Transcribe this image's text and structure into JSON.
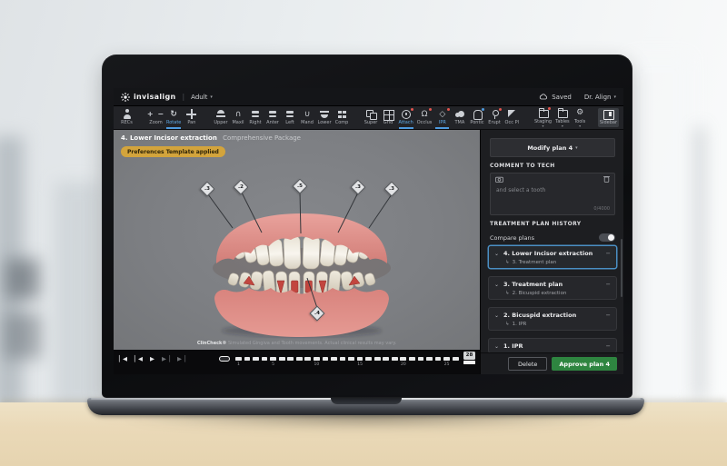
{
  "topbar": {
    "logo": "invisalign",
    "mode": "Adult",
    "saved_label": "Saved",
    "doctor": "Dr. Align"
  },
  "toolbar": {
    "items": [
      {
        "label": "RECs",
        "icon": "person-icon"
      },
      {
        "label": "Zoom",
        "icon": "zoom-icon",
        "gap": true
      },
      {
        "label": "Rotate",
        "icon": "rotate-icon",
        "active": true
      },
      {
        "label": "Pan",
        "icon": "pan-icon"
      },
      {
        "label": "Upper",
        "icon": "upper-view-icon",
        "gap": true
      },
      {
        "label": "Maxil",
        "icon": "maxillary-arch-icon"
      },
      {
        "label": "Right",
        "icon": "right-view-icon"
      },
      {
        "label": "Anter",
        "icon": "anterior-view-icon"
      },
      {
        "label": "Left",
        "icon": "left-view-icon"
      },
      {
        "label": "Mand",
        "icon": "mandibular-arch-icon"
      },
      {
        "label": "Lower",
        "icon": "lower-view-icon"
      },
      {
        "label": "Comp",
        "icon": "composite-view-icon"
      },
      {
        "label": "Super",
        "icon": "superimpose-icon",
        "gap": true
      },
      {
        "label": "Grid",
        "icon": "grid-icon"
      },
      {
        "label": "Attach",
        "icon": "attachments-icon",
        "active": true,
        "dot": "red"
      },
      {
        "label": "Occlus",
        "icon": "occlusion-icon",
        "dot": "red"
      },
      {
        "label": "IPR",
        "icon": "ipr-icon",
        "active": true,
        "dot": "red"
      },
      {
        "label": "TMA",
        "icon": "tma-icon"
      },
      {
        "label": "Pontic",
        "icon": "pontic-icon",
        "dot": "blue"
      },
      {
        "label": "Erupt",
        "icon": "eruption-icon",
        "dot": "red"
      },
      {
        "label": "Occ Pl",
        "icon": "occlusal-plane-icon"
      },
      {
        "label": "Staging",
        "icon": "staging-icon",
        "dot": "red",
        "caret": true,
        "gap": true
      },
      {
        "label": "Tables",
        "icon": "tables-icon",
        "caret": true
      },
      {
        "label": "Tools",
        "icon": "tools-icon",
        "caret": true
      },
      {
        "label": "Sidebar",
        "icon": "sidebar-icon",
        "boxed": true,
        "push": true
      }
    ],
    "glyphs": {
      "zoom-icon": "+ −",
      "rotate-icon": "↻",
      "maxillary-arch-icon": "∩",
      "mandibular-arch-icon": "∪",
      "occlusion-icon": "Ω",
      "ipr-icon": "◇",
      "tools-icon": "⚙"
    }
  },
  "viewport": {
    "plan_title": "4. Lower Incisor extraction",
    "package": "Comprehensive Package",
    "badge": "Preferences Template applied",
    "disclaimer_brand": "ClinCheck®",
    "disclaimer_text": "Simulated Gingiva and Tooth movements. Actual clinical results may vary.",
    "ipr_markers": [
      {
        "value": ".3"
      },
      {
        "value": ".2"
      },
      {
        "value": ".5"
      },
      {
        "value": ".3"
      },
      {
        "value": ".3"
      },
      {
        "value": ".4"
      }
    ]
  },
  "timeline": {
    "total_segments": 28,
    "end_stage": "28",
    "ticks": [
      {
        "label": "1",
        "seg": 1
      },
      {
        "label": "5",
        "seg": 5
      },
      {
        "label": "10",
        "seg": 10
      },
      {
        "label": "15",
        "seg": 15
      },
      {
        "label": "20",
        "seg": 20
      },
      {
        "label": "25",
        "seg": 25
      }
    ],
    "controls": [
      {
        "name": "skip-to-start-button",
        "glyph": "▏◀"
      },
      {
        "name": "step-back-button",
        "glyph": "▏◀"
      },
      {
        "name": "play-button",
        "glyph": "▶"
      },
      {
        "name": "step-forward-button",
        "glyph": "▶▕",
        "dim": true
      },
      {
        "name": "skip-to-end-button",
        "glyph": "▶▕",
        "dim": true
      }
    ]
  },
  "sidebar": {
    "modify_button": "Modify plan 4",
    "comment_header": "COMMENT TO TECH",
    "comment_placeholder": "and select a tooth",
    "comment_counter": "0/4000",
    "history_header": "TREATMENT PLAN HISTORY",
    "compare_label": "Compare plans",
    "plans": [
      {
        "title": "4. Lower Incisor extraction",
        "sub": "3. Treatment plan",
        "selected": true
      },
      {
        "title": "3. Treatment plan",
        "sub": "2. Bicuspid extraction"
      },
      {
        "title": "2. Bicuspid extraction",
        "sub": "1. IPR"
      },
      {
        "title": "1. IPR"
      }
    ],
    "delete_button": "Delete",
    "approve_button": "Approve plan 4"
  },
  "colors": {
    "accent_blue": "#4e9ade",
    "approve_green": "#2e8540",
    "badge_amber": "#d3a43c",
    "alert_red": "#e2554f"
  }
}
